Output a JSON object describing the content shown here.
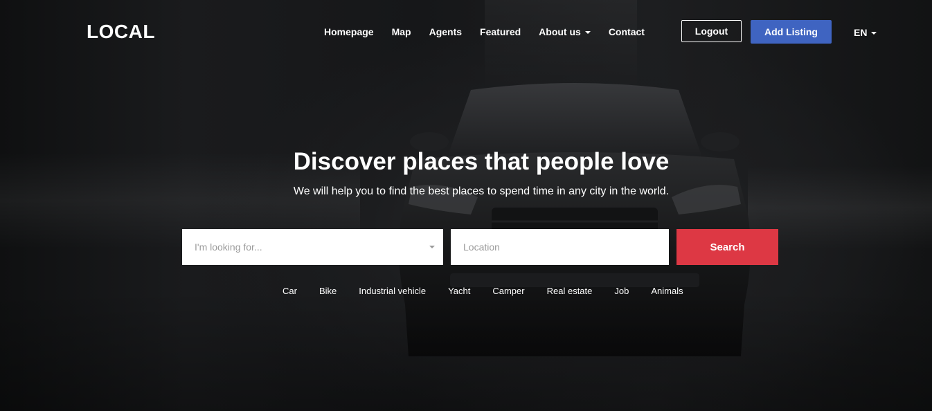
{
  "brand": {
    "logo": "LOCAL"
  },
  "nav": {
    "items": [
      {
        "label": "Homepage",
        "has_dropdown": false
      },
      {
        "label": "Map",
        "has_dropdown": false
      },
      {
        "label": "Agents",
        "has_dropdown": false
      },
      {
        "label": "Featured",
        "has_dropdown": false
      },
      {
        "label": "About us",
        "has_dropdown": true
      },
      {
        "label": "Contact",
        "has_dropdown": false
      }
    ]
  },
  "header_actions": {
    "logout_label": "Logout",
    "add_listing_label": "Add Listing",
    "language": "EN"
  },
  "hero": {
    "title": "Discover places that people love",
    "subtitle": "We will help you to find the best places to spend time in any city in the world."
  },
  "search": {
    "category_placeholder": "I'm looking for...",
    "location_placeholder": "Location",
    "location_value": "",
    "button_label": "Search"
  },
  "categories": [
    "Car",
    "Bike",
    "Industrial vehicle",
    "Yacht",
    "Camper",
    "Real estate",
    "Job",
    "Animals"
  ],
  "colors": {
    "add_listing_bg": "#3f64c1",
    "search_button_bg": "#dd3844",
    "background": "#17181a",
    "text": "#ffffff",
    "placeholder": "#9a9a9a"
  },
  "icons": {
    "nav_dropdown": "chevron-down-icon",
    "language_dropdown": "chevron-down-icon",
    "category_select": "chevron-down-icon"
  }
}
